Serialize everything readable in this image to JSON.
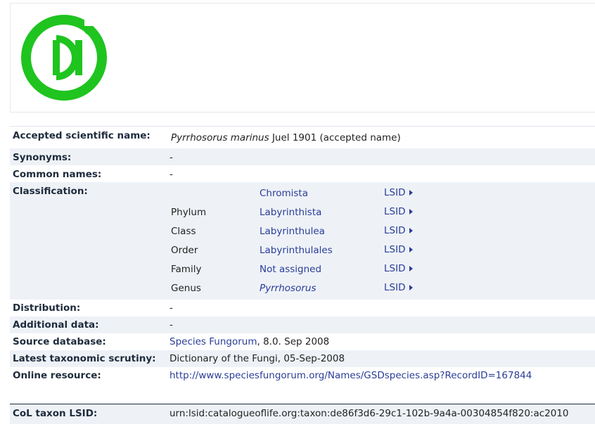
{
  "colors": {
    "logo_green": "#1fc41f",
    "link": "#2a3d97",
    "label": "#1e2b3c",
    "row_shade": "#eef2f7"
  },
  "logo": {
    "icon": "catalogue-of-life-logo"
  },
  "record": {
    "accepted_name": {
      "label": "Accepted scientific name:",
      "genus_species": "Pyrrhosorus marinus",
      "author": "Juel 1901 (accepted name)"
    },
    "synonyms": {
      "label": "Synonyms:",
      "value": "-"
    },
    "common_names": {
      "label": "Common names:",
      "value": "-"
    },
    "classification": {
      "label": "Classification:",
      "rows": [
        {
          "rank": "",
          "taxon": "Chromista",
          "lsid": "LSID"
        },
        {
          "rank": "Phylum",
          "taxon": "Labyrinthista",
          "lsid": "LSID"
        },
        {
          "rank": "Class",
          "taxon": "Labyrinthulea",
          "lsid": "LSID"
        },
        {
          "rank": "Order",
          "taxon": "Labyrinthulales",
          "lsid": "LSID"
        },
        {
          "rank": "Family",
          "taxon": "Not assigned",
          "lsid": "LSID"
        },
        {
          "rank": "Genus",
          "taxon": "Pyrrhosorus",
          "lsid": "LSID"
        }
      ]
    },
    "distribution": {
      "label": "Distribution:",
      "value": "-"
    },
    "additional_data": {
      "label": "Additional data:",
      "value": "-"
    },
    "source_database": {
      "label": "Source database:",
      "link": "Species Fungorum",
      "suffix": ", 8.0. Sep 2008"
    },
    "scrutiny": {
      "label": "Latest taxonomic scrutiny:",
      "value": "Dictionary of the Fungi, 05-Sep-2008"
    },
    "online_resource": {
      "label": "Online resource:",
      "url": "http://www.speciesfungorum.org/Names/GSDspecies.asp?RecordID=167844"
    },
    "col_lsid": {
      "label": "CoL taxon LSID:",
      "value": "urn:lsid:catalogueoflife.org:taxon:de86f3d6-29c1-102b-9a4a-00304854f820:ac2010"
    }
  }
}
